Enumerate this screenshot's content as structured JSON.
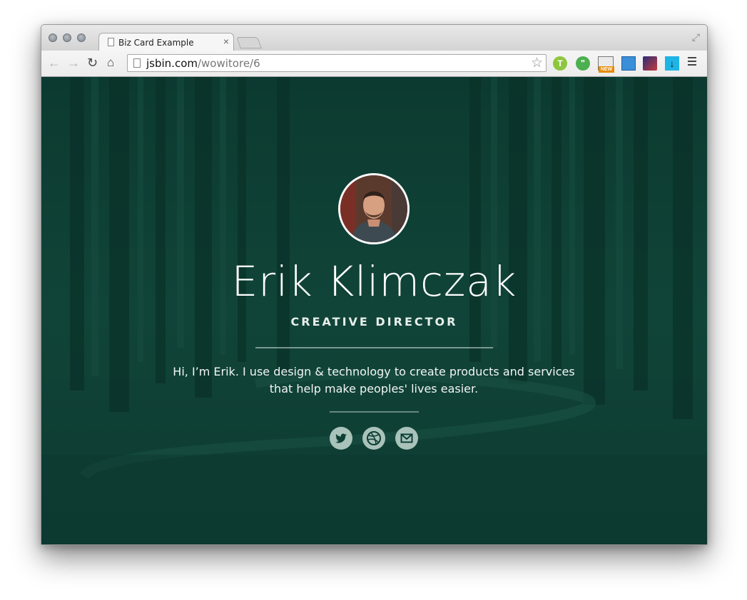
{
  "browser": {
    "tab_title": "Biz Card Example",
    "tab_close": "×",
    "url_host": "jsbin.com",
    "url_path": "/wowitore/6",
    "extension_new_badge": "NEW",
    "icons": [
      "back-arrow-icon",
      "forward-arrow-icon",
      "reload-icon",
      "home-icon",
      "bookmark-star-icon",
      "menu-icon"
    ]
  },
  "card": {
    "name": "Erik Klimczak",
    "role": "CREATIVE DIRECTOR",
    "bio": "Hi, I’m Erik. I use design & technology to create products and services that help make peoples' lives easier.",
    "social": [
      "twitter-icon",
      "dribbble-icon",
      "mail-icon"
    ],
    "colors": {
      "overlay": "#0f3f34",
      "icon_bg": "#a9c3bb",
      "icon_fg": "#0f3f34"
    }
  }
}
